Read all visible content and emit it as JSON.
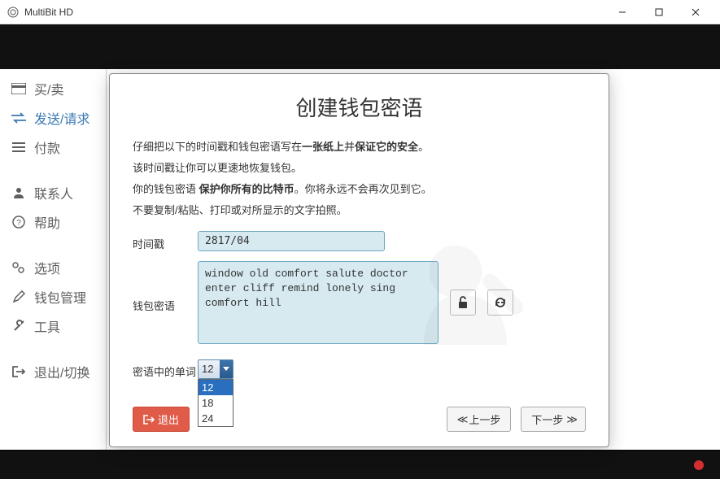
{
  "window": {
    "title": "MultiBit HD"
  },
  "sidebar": {
    "buy_sell": "买/卖",
    "send_request": "发送/请求",
    "payments": "付款",
    "contacts": "联系人",
    "help": "帮助",
    "options": "选项",
    "wallet_mgmt": "钱包管理",
    "tools": "工具",
    "exit_switch": "退出/切换"
  },
  "modal": {
    "title": "创建钱包密语",
    "desc_line1_a": "仔细把以下的时间戳和钱包密语写在",
    "desc_line1_b": "一张纸上",
    "desc_line1_c": "并",
    "desc_line1_d": "保证它的安全",
    "desc_line1_e": "。",
    "desc_line2": "该时间戳让你可以更速地恢复钱包。",
    "desc_line3_a": "你的钱包密语",
    "desc_line3_b": " 保护你所有的比特币",
    "desc_line3_c": "。你将永远不会再次见到它。",
    "desc_line4": "不要复制/粘贴、打印或对所显示的文字拍照。",
    "timestamp_label": "时间戳",
    "timestamp_value": "2817/04",
    "seed_label": "钱包密语",
    "seed_value": "window old comfort salute doctor\nenter cliff remind lonely sing\ncomfort hill",
    "wordcount_label": "密语中的单词",
    "wordcount_value": "12",
    "wordcount_options": [
      "12",
      "18",
      "24"
    ],
    "exit_btn": "退出",
    "prev_btn": "上一步",
    "next_btn": "下一步"
  }
}
